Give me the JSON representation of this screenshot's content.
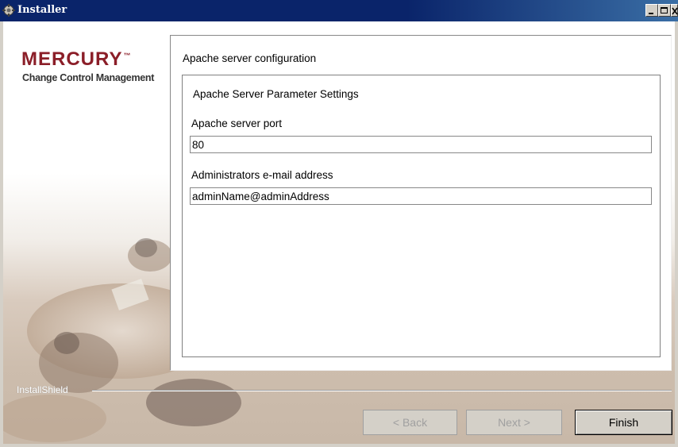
{
  "window": {
    "title": "Installer"
  },
  "logo": {
    "brand": "MERCURY",
    "tm": "™",
    "subtitle": "Change Control Management"
  },
  "panel": {
    "heading": "Apache server configuration",
    "section_title": "Apache Server Parameter Settings",
    "port_label": "Apache server port",
    "port_value": "80",
    "email_label": "Administrators e-mail address",
    "email_value": "adminName@adminAddress"
  },
  "footer": {
    "brand": "InstallShield"
  },
  "buttons": {
    "back": "< Back",
    "next": "Next >",
    "finish": "Finish"
  },
  "colors": {
    "title_bar": "#0a246a",
    "logo_red": "#8b1e28",
    "dialog_bg": "#d4d0c8"
  },
  "icons": {
    "title_icon": "installer-gear-icon",
    "minimize": "minimize-icon",
    "maximize": "maximize-icon",
    "close": "close-icon"
  }
}
